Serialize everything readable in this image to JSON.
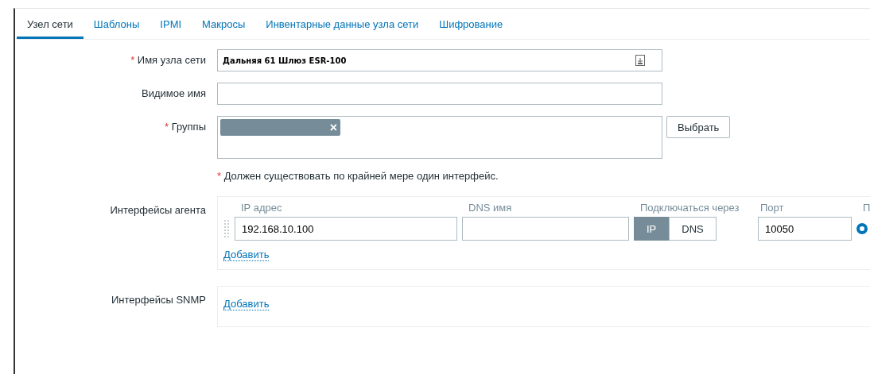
{
  "tabs": [
    {
      "label": "Узел сети",
      "selected": true
    },
    {
      "label": "Шаблоны",
      "selected": false
    },
    {
      "label": "IPMI",
      "selected": false
    },
    {
      "label": "Макросы",
      "selected": false
    },
    {
      "label": "Инвентарные данные узла сети",
      "selected": false
    },
    {
      "label": "Шифрование",
      "selected": false
    }
  ],
  "host_name": {
    "label": "Имя узла сети",
    "required": true,
    "value": "Дальняя 61 Шлюз ESR-100"
  },
  "visible_name": {
    "label": "Видимое имя",
    "required": false
  },
  "groups": {
    "label": "Группы",
    "required": true,
    "chip_remove": "×",
    "select_button": "Выбрать"
  },
  "notice": {
    "mark": "*",
    "text": "Должен существовать по крайней мере один интерфейс."
  },
  "agent_interfaces": {
    "label": "Интерфейсы агента",
    "columns": [
      "IP адрес",
      "DNS имя",
      "Подключаться через",
      "Порт",
      "П"
    ],
    "rows": [
      {
        "ip": "192.168.10.100",
        "connect_options": [
          {
            "label": "IP",
            "selected": true
          },
          {
            "label": "DNS",
            "selected": false
          }
        ],
        "port": "10050",
        "default": true
      }
    ],
    "add_link": "Добавить"
  },
  "snmp_interfaces": {
    "label": "Интерфейсы SNMP",
    "add_link": "Добавить"
  }
}
